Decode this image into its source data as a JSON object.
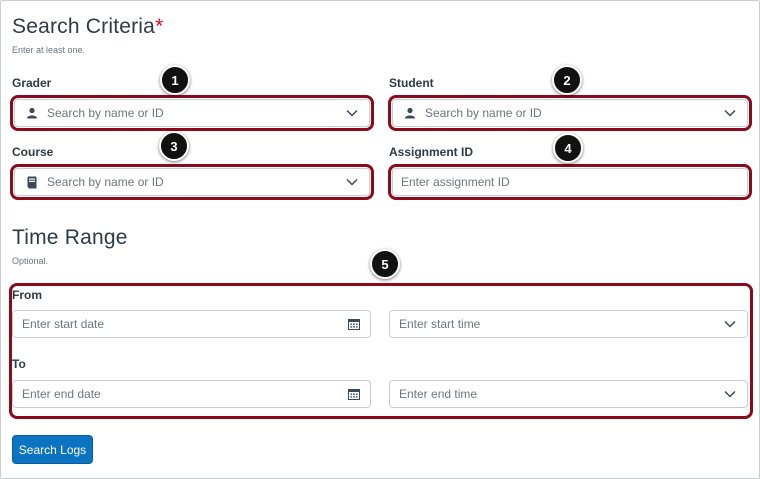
{
  "search_criteria": {
    "title": "Search Criteria",
    "required_mark": "*",
    "hint": "Enter at least one.",
    "grader": {
      "label": "Grader",
      "placeholder": "Search by name or ID",
      "icon": "user-icon"
    },
    "student": {
      "label": "Student",
      "placeholder": "Search by name or ID",
      "icon": "user-icon"
    },
    "course": {
      "label": "Course",
      "placeholder": "Search by name or ID",
      "icon": "book-icon"
    },
    "assignment": {
      "label": "Assignment ID",
      "placeholder": "Enter assignment ID"
    }
  },
  "time_range": {
    "title": "Time Range",
    "hint": "Optional.",
    "from": {
      "label": "From",
      "date_placeholder": "Enter start date",
      "time_placeholder": "Enter start time"
    },
    "to": {
      "label": "To",
      "date_placeholder": "Enter end date",
      "time_placeholder": "Enter end time"
    }
  },
  "search_button": {
    "label": "Search Logs"
  },
  "callouts": [
    "1",
    "2",
    "3",
    "4",
    "5"
  ],
  "colors": {
    "highlight": "#8b0a1b",
    "button": "#0b74c2",
    "required": "#e0061f",
    "badge": "#111111"
  }
}
